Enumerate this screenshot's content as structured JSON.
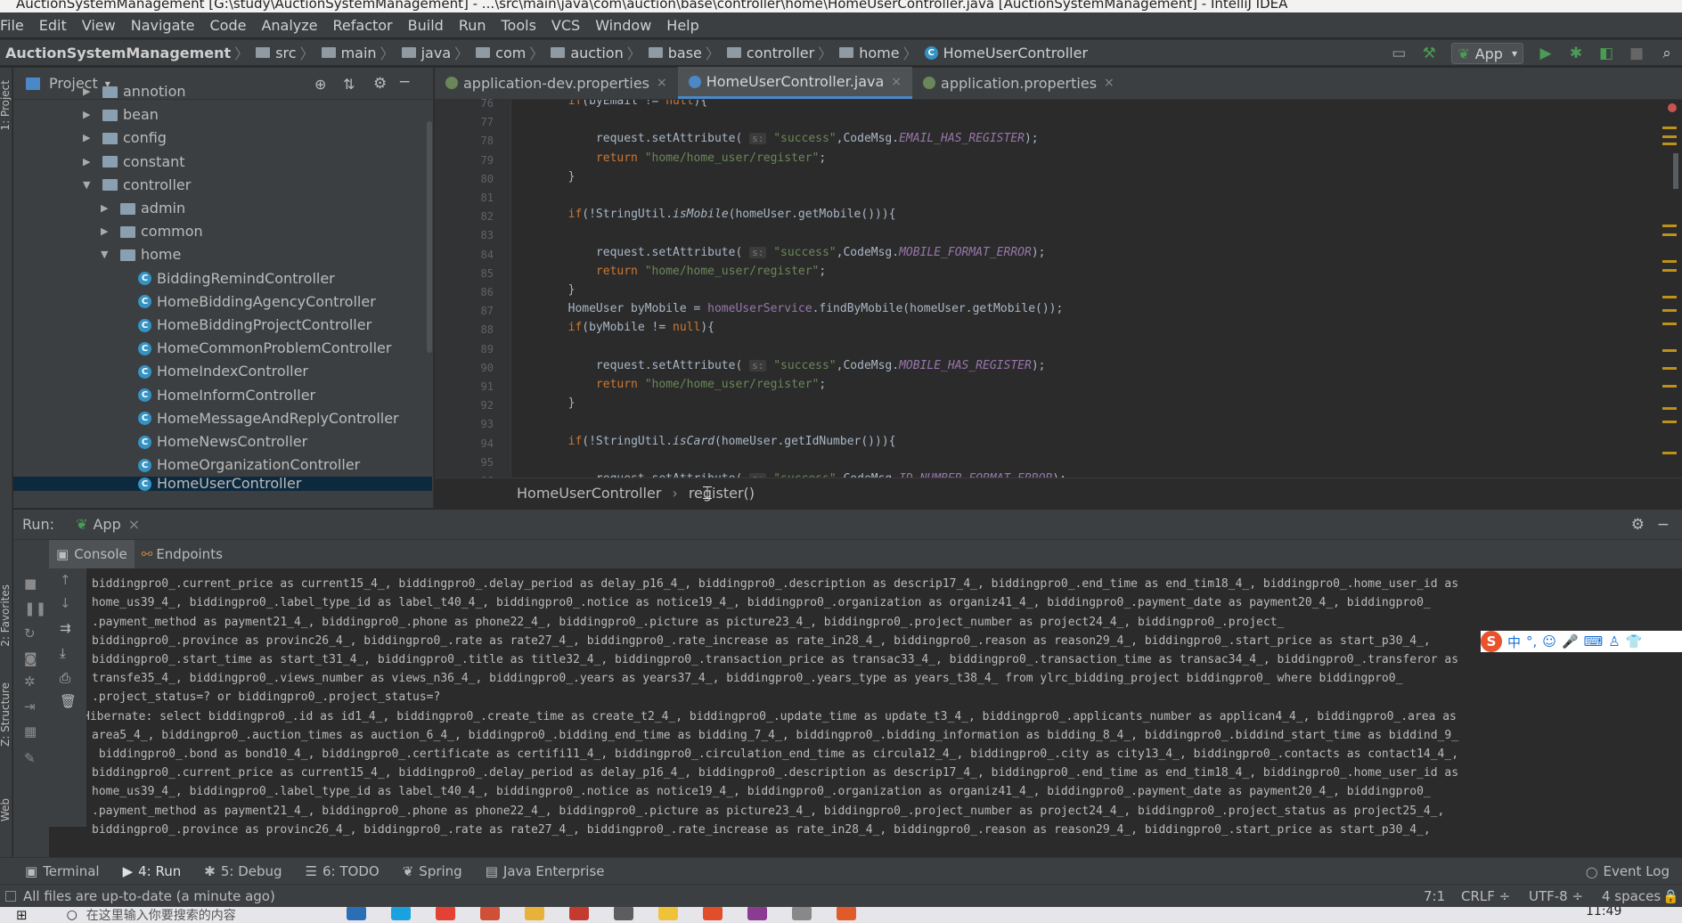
{
  "window": {
    "title": "AuctionSystemManagement [G:\\study\\AuctionSystemManagement] - ...\\src\\main\\java\\com\\auction\\base\\controller\\home\\HomeUserController.java [AuctionSystemManagement] - IntelliJ IDEA"
  },
  "menu": [
    "File",
    "Edit",
    "View",
    "Navigate",
    "Code",
    "Analyze",
    "Refactor",
    "Build",
    "Run",
    "Tools",
    "VCS",
    "Window",
    "Help"
  ],
  "breadcrumb": [
    "AuctionSystemManagement",
    "src",
    "main",
    "java",
    "com",
    "auction",
    "base",
    "controller",
    "home",
    "HomeUserController"
  ],
  "toolbar": {
    "run_config": "App",
    "run_config_arrow": "▾",
    "icons": [
      "build-icon",
      "hammer-icon",
      "run-icon",
      "debug-icon",
      "coverage-icon",
      "stop-icon",
      "search-icon"
    ]
  },
  "project_panel": {
    "title": "Project",
    "dropdown": "▾",
    "tree": [
      {
        "label": "annotion",
        "kind": "folder",
        "arrow": "▶",
        "depth": 1
      },
      {
        "label": "bean",
        "kind": "folder",
        "arrow": "▶",
        "depth": 1
      },
      {
        "label": "config",
        "kind": "folder",
        "arrow": "▶",
        "depth": 1
      },
      {
        "label": "constant",
        "kind": "folder",
        "arrow": "▶",
        "depth": 1
      },
      {
        "label": "controller",
        "kind": "folder",
        "arrow": "▼",
        "depth": 1
      },
      {
        "label": "admin",
        "kind": "folder",
        "arrow": "▶",
        "depth": 2
      },
      {
        "label": "common",
        "kind": "folder",
        "arrow": "▶",
        "depth": 2
      },
      {
        "label": "home",
        "kind": "folder",
        "arrow": "▼",
        "depth": 2
      },
      {
        "label": "BiddingRemindController",
        "kind": "class",
        "depth": 3
      },
      {
        "label": "HomeBiddingAgencyController",
        "kind": "class",
        "depth": 3
      },
      {
        "label": "HomeBiddingProjectController",
        "kind": "class",
        "depth": 3
      },
      {
        "label": "HomeCommonProblemController",
        "kind": "class",
        "depth": 3
      },
      {
        "label": "HomeIndexController",
        "kind": "class",
        "depth": 3
      },
      {
        "label": "HomeInformController",
        "kind": "class",
        "depth": 3
      },
      {
        "label": "HomeMessageAndReplyController",
        "kind": "class",
        "depth": 3
      },
      {
        "label": "HomeNewsController",
        "kind": "class",
        "depth": 3
      },
      {
        "label": "HomeOrganizationController",
        "kind": "class",
        "depth": 3
      },
      {
        "label": "HomeUserController",
        "kind": "class",
        "depth": 3
      }
    ]
  },
  "side_labels": {
    "project": "1: Project",
    "favorites": "2: Favorites",
    "structure": "Z: Structure",
    "web": "Web"
  },
  "editor": {
    "tabs": [
      {
        "label": "application-dev.properties",
        "close": "×"
      },
      {
        "label": "HomeUserController.java",
        "close": "×"
      },
      {
        "label": "application.properties",
        "close": "×"
      }
    ],
    "line_numbers": [
      "76",
      "77",
      "78",
      "79",
      "80",
      "81",
      "82",
      "83",
      "84",
      "85",
      "86",
      "87",
      "88",
      "89",
      "90",
      "91",
      "92",
      "93",
      "94",
      "95",
      "96"
    ],
    "code": [
      "        if(byEmail != null){",
      "",
      "            request.setAttribute( s: \"success\",CodeMsg.EMAIL_HAS_REGISTER);",
      "            return \"home/home_user/register\";",
      "        }",
      "",
      "        if(!StringUtil.isMobile(homeUser.getMobile())){",
      "",
      "            request.setAttribute( s: \"success\",CodeMsg.MOBILE_FORMAT_ERROR);",
      "            return \"home/home_user/register\";",
      "        }",
      "        HomeUser byMobile = homeUserService.findByMobile(homeUser.getMobile());",
      "        if(byMobile != null){",
      "",
      "            request.setAttribute( s: \"success\",CodeMsg.MOBILE_HAS_REGISTER);",
      "            return \"home/home_user/register\";",
      "        }",
      "",
      "        if(!StringUtil.isCard(homeUser.getIdNumber())){",
      "",
      "            request.setAttribute( s: \"success\",CodeMsg.ID_NUMBER_FORMAT_ERROR);"
    ],
    "breadcrumb": [
      "HomeUserController",
      "register()"
    ],
    "breadcrumb_sep": "›"
  },
  "run_panel": {
    "label": "Run:",
    "config": "App",
    "close": "×",
    "tabs": [
      "Console",
      "Endpoints"
    ],
    "console_lines": [
      " biddingpro0_.bond as bond10_4_, biddingpro0_.certificate as certifi11_4_, biddingpro0_.circulation_end_time as circula12_4_, biddingpro0_.city as city13_4_, biddingpro0_.contacts as contact14_4_,",
      "biddingpro0_.current_price as current15_4_, biddingpro0_.delay_period as delay_p16_4_, biddingpro0_.description as descrip17_4_, biddingpro0_.end_time as end_tim18_4_, biddingpro0_.home_user_id as",
      "home_us39_4_, biddingpro0_.label_type_id as label_t40_4_, biddingpro0_.notice as notice19_4_, biddingpro0_.organization as organiz41_4_, biddingpro0_.payment_date as payment20_4_, biddingpro0_",
      ".payment_method as payment21_4_, biddingpro0_.phone as phone22_4_, biddingpro0_.picture as picture23_4_, biddingpro0_.project_number as project24_4_, biddingpro0_.project_",
      "biddingpro0_.province as provinc26_4_, biddingpro0_.rate as rate27_4_, biddingpro0_.rate_increase as rate_in28_4_, biddingpro0_.reason as reason29_4_, biddingpro0_.start_price as start_p30_4_,",
      "biddingpro0_.start_time as start_t31_4_, biddingpro0_.title as title32_4_, biddingpro0_.transaction_price as transac33_4_, biddingpro0_.transaction_time as transac34_4_, biddingpro0_.transferor as",
      "transfe35_4_, biddingpro0_.views_number as views_n36_4_, biddingpro0_.years as years37_4_, biddingpro0_.years_type as years_t38_4_ from ylrc_bidding_project biddingpro0_ where biddingpro0_",
      ".project_status=? or biddingpro0_.project_status=?",
      "Hibernate: select biddingpro0_.id as id1_4_, biddingpro0_.create_time as create_t2_4_, biddingpro0_.update_time as update_t3_4_, biddingpro0_.applicants_number as applican4_4_, biddingpro0_.area as",
      "area5_4_, biddingpro0_.auction_times as auction_6_4_, biddingpro0_.bidding_end_time as bidding_7_4_, biddingpro0_.bidding_information as bidding_8_4_, biddingpro0_.biddind_start_time as biddind_9_",
      " biddingpro0_.bond as bond10_4_, biddingpro0_.certificate as certifi11_4_, biddingpro0_.circulation_end_time as circula12_4_, biddingpro0_.city as city13_4_, biddingpro0_.contacts as contact14_4_,",
      "biddingpro0_.current_price as current15_4_, biddingpro0_.delay_period as delay_p16_4_, biddingpro0_.description as descrip17_4_, biddingpro0_.end_time as end_tim18_4_, biddingpro0_.home_user_id as",
      "home_us39_4_, biddingpro0_.label_type_id as label_t40_4_, biddingpro0_.notice as notice19_4_, biddingpro0_.organization as organiz41_4_, biddingpro0_.payment_date as payment20_4_, biddingpro0_",
      ".payment_method as payment21_4_, biddingpro0_.phone as phone22_4_, biddingpro0_.picture as picture23_4_, biddingpro0_.project_number as project24_4_, biddingpro0_.project_status as project25_4_,",
      "biddingpro0_.province as provinc26_4_, biddingpro0_.rate as rate27_4_, biddingpro0_.rate_increase as rate_in28_4_, biddingpro0_.reason as reason29_4_, biddingpro0_.start_price as start_p30_4_,"
    ]
  },
  "ime": {
    "logo": "S",
    "lang": "中",
    "punct": "°,"
  },
  "tool_windows": [
    {
      "label": "Terminal",
      "icon": "▣"
    },
    {
      "label": "4: Run",
      "icon": "▶"
    },
    {
      "label": "5: Debug",
      "icon": "✱"
    },
    {
      "label": "6: TODO",
      "icon": "☰"
    },
    {
      "label": "Spring",
      "icon": "❦"
    },
    {
      "label": "Java Enterprise",
      "icon": "▤"
    }
  ],
  "event_log": "Event Log",
  "status": {
    "message": "All files are up-to-date (a minute ago)",
    "position": "7:1",
    "line_sep": "CRLF ÷",
    "encoding": "UTF-8 ÷",
    "indent": "4 spaces ÷"
  },
  "taskbar": {
    "search_placeholder": "在这里输入你要搜索的内容",
    "time": "11:49"
  },
  "colors": {
    "accent": "#4a88c7",
    "keyword": "#cc7832",
    "string": "#6a8759",
    "constant": "#9876aa",
    "run_green": "#499c54"
  }
}
